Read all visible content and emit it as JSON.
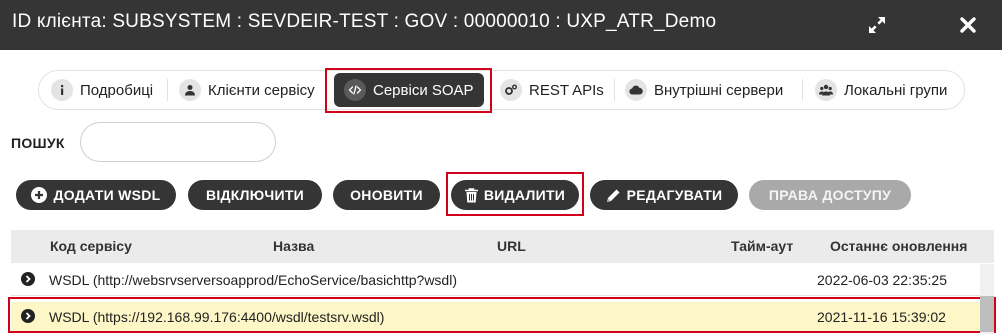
{
  "window": {
    "title": "ID клієнта: SUBSYSTEM : SEVDEIR-TEST : GOV : 00000010 : UXP_ATR_Demo",
    "expand_icon": "expand-icon",
    "close_icon": "close-icon"
  },
  "tabs": [
    {
      "label": "Подробиці",
      "icon": "info-icon",
      "active": false
    },
    {
      "label": "Клієнти сервісу",
      "icon": "user-icon",
      "active": false
    },
    {
      "label": "Сервіси SOAP",
      "icon": "code-icon",
      "active": true
    },
    {
      "label": "REST APIs",
      "icon": "cogs-icon",
      "active": false
    },
    {
      "label": "Внутрішні сервери",
      "icon": "cloud-icon",
      "active": false
    },
    {
      "label": "Локальні групи",
      "icon": "users-icon",
      "active": false
    }
  ],
  "search": {
    "label": "ПОШУК",
    "value": "",
    "placeholder": ""
  },
  "toolbar": {
    "add_wsdl": "ДОДАТИ WSDL",
    "disable": "ВІДКЛЮЧИТИ",
    "refresh": "ОНОВИТИ",
    "delete": "ВИДАЛИТИ",
    "edit": "РЕДАГУВАТИ",
    "access_rights": "ПРАВА ДОСТУПУ"
  },
  "table": {
    "columns": {
      "service_code": "Код сервісу",
      "name": "Назва",
      "url": "URL",
      "timeout": "Тайм-аут",
      "last_refresh": "Останнє оновлення"
    },
    "rows": [
      {
        "wsdl": "WSDL (http://websrvserversoapprod/EchoService/basichttp?wsdl)",
        "last_refresh": "2022-06-03 22:35:25",
        "selected": false
      },
      {
        "wsdl": "WSDL (https://192.168.99.176:4400/wsdl/testsrv.wsdl)",
        "last_refresh": "2021-11-16 15:39:02",
        "selected": true
      }
    ]
  },
  "colors": {
    "titlebar": "#353535",
    "button": "#353535",
    "button_disabled": "#a9a9a9",
    "highlight": "#d0021b",
    "selected_row": "#fdf7c7"
  }
}
